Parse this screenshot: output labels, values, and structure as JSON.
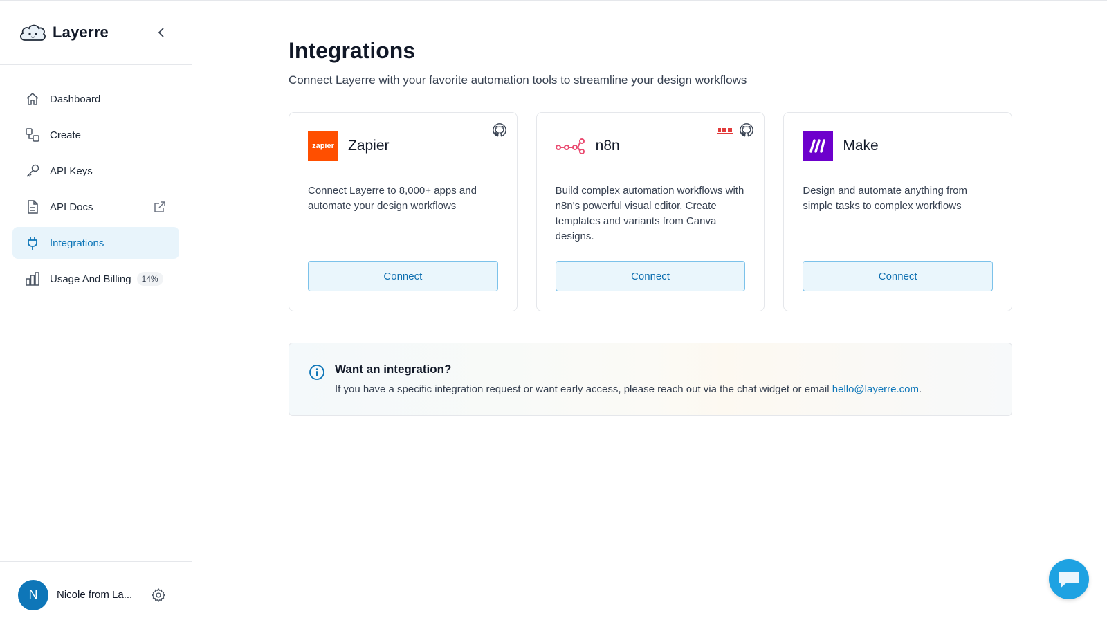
{
  "brand": {
    "name": "Layerre",
    "logo_icon": "cloud-mascot-icon"
  },
  "sidebar": {
    "items": [
      {
        "label": "Dashboard",
        "icon": "home-icon"
      },
      {
        "label": "Create",
        "icon": "shapes-icon"
      },
      {
        "label": "API Keys",
        "icon": "key-icon"
      },
      {
        "label": "API Docs",
        "icon": "document-icon",
        "trailing_icon": "external-link-icon"
      },
      {
        "label": "Integrations",
        "icon": "plug-icon",
        "active": true
      },
      {
        "label": "Usage And Billing",
        "icon": "bar-chart-icon",
        "badge": "14%"
      }
    ]
  },
  "user": {
    "initial": "N",
    "name": "Nicole from La..."
  },
  "page": {
    "title": "Integrations",
    "subtitle": "Connect Layerre with your favorite automation tools to streamline your design workflows"
  },
  "cards": [
    {
      "title": "Zapier",
      "logo_text": "zapier",
      "description": "Connect Layerre to 8,000+ apps and automate your design workflows",
      "button": "Connect"
    },
    {
      "title": "n8n",
      "description": "Build complex automation workflows with n8n's powerful visual editor. Create templates and variants from Canva designs.",
      "button": "Connect"
    },
    {
      "title": "Make",
      "description": "Design and automate anything from simple tasks to complex workflows",
      "button": "Connect"
    }
  ],
  "info": {
    "title": "Want an integration?",
    "text": "If you have a specific integration request or want early access, please reach out via the chat widget or email ",
    "email": "hello@layerre.com",
    "suffix": "."
  },
  "colors": {
    "accent": "#0e76b8",
    "active_bg": "#e8f4fb",
    "zapier": "#ff4f00",
    "n8n": "#ea4b71",
    "make": "#6d00cc",
    "chat": "#1ea2e2"
  }
}
